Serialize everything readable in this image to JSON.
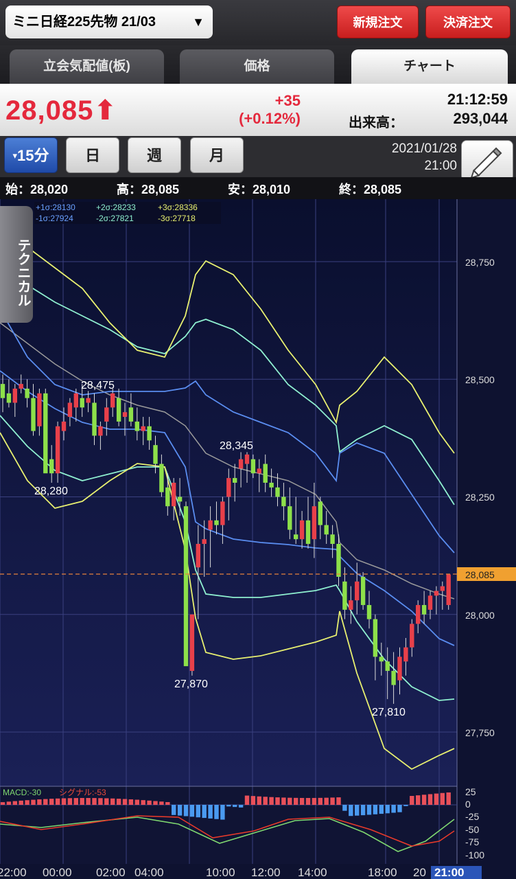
{
  "header": {
    "symbol": "ミニ日経225先物 21/03",
    "new_order": "新規注文",
    "settle_order": "決済注文"
  },
  "tabs": [
    {
      "label": "立会気配値(板)"
    },
    {
      "label": "価格"
    },
    {
      "label": "チャート"
    }
  ],
  "quote": {
    "last": "28,085",
    "change": "+35",
    "change_pct": "(+0.12%)",
    "time": "21:12:59",
    "volume_label": "出来高：",
    "volume": "293,044"
  },
  "periods": [
    "15分",
    "日",
    "週",
    "月"
  ],
  "datetime": {
    "date": "2021/01/28",
    "time": "21:00"
  },
  "ohlc": {
    "open": "始：28,020",
    "high": "高：28,085",
    "low": "安：28,010",
    "close": "終：28,085"
  },
  "technical_label": "テクニカル",
  "bollinger_legend": {
    "p1": "+1σ:28130",
    "p2": "+2σ:28233",
    "p3": "+3σ:28336",
    "m1": "-1σ:27924",
    "m2": "-2σ:27821",
    "m3": "-3σ:27718"
  },
  "macd_legend": {
    "macd": "MACD:-30",
    "signal": "シグナル:-53"
  },
  "chart_data": {
    "type": "candlestick",
    "price_axis": [
      "28,750",
      "28,500",
      "28,250",
      "28,085",
      "28,000",
      "27,750"
    ],
    "macd_axis": [
      "25",
      "0",
      "-25",
      "-50",
      "-75",
      "-100"
    ],
    "time_axis": [
      "22:00",
      "00:00",
      "02:00",
      "04:00",
      "10:00",
      "12:00",
      "14:00",
      "18:00",
      "20",
      "21:00"
    ],
    "annotations": [
      "28,475",
      "28,280",
      "28,345",
      "27,870",
      "27,810"
    ],
    "current_price": 28085,
    "ylim": [
      27650,
      28870
    ],
    "colors": {
      "up": "#e8404a",
      "down": "#8de04a",
      "ma": "#9a9a9a",
      "s1": "#5a8df0",
      "s2": "#8ff0d0",
      "s3": "#e8f070",
      "bg_top": "#0a0f2e",
      "bg_bottom": "#1a2056"
    }
  }
}
